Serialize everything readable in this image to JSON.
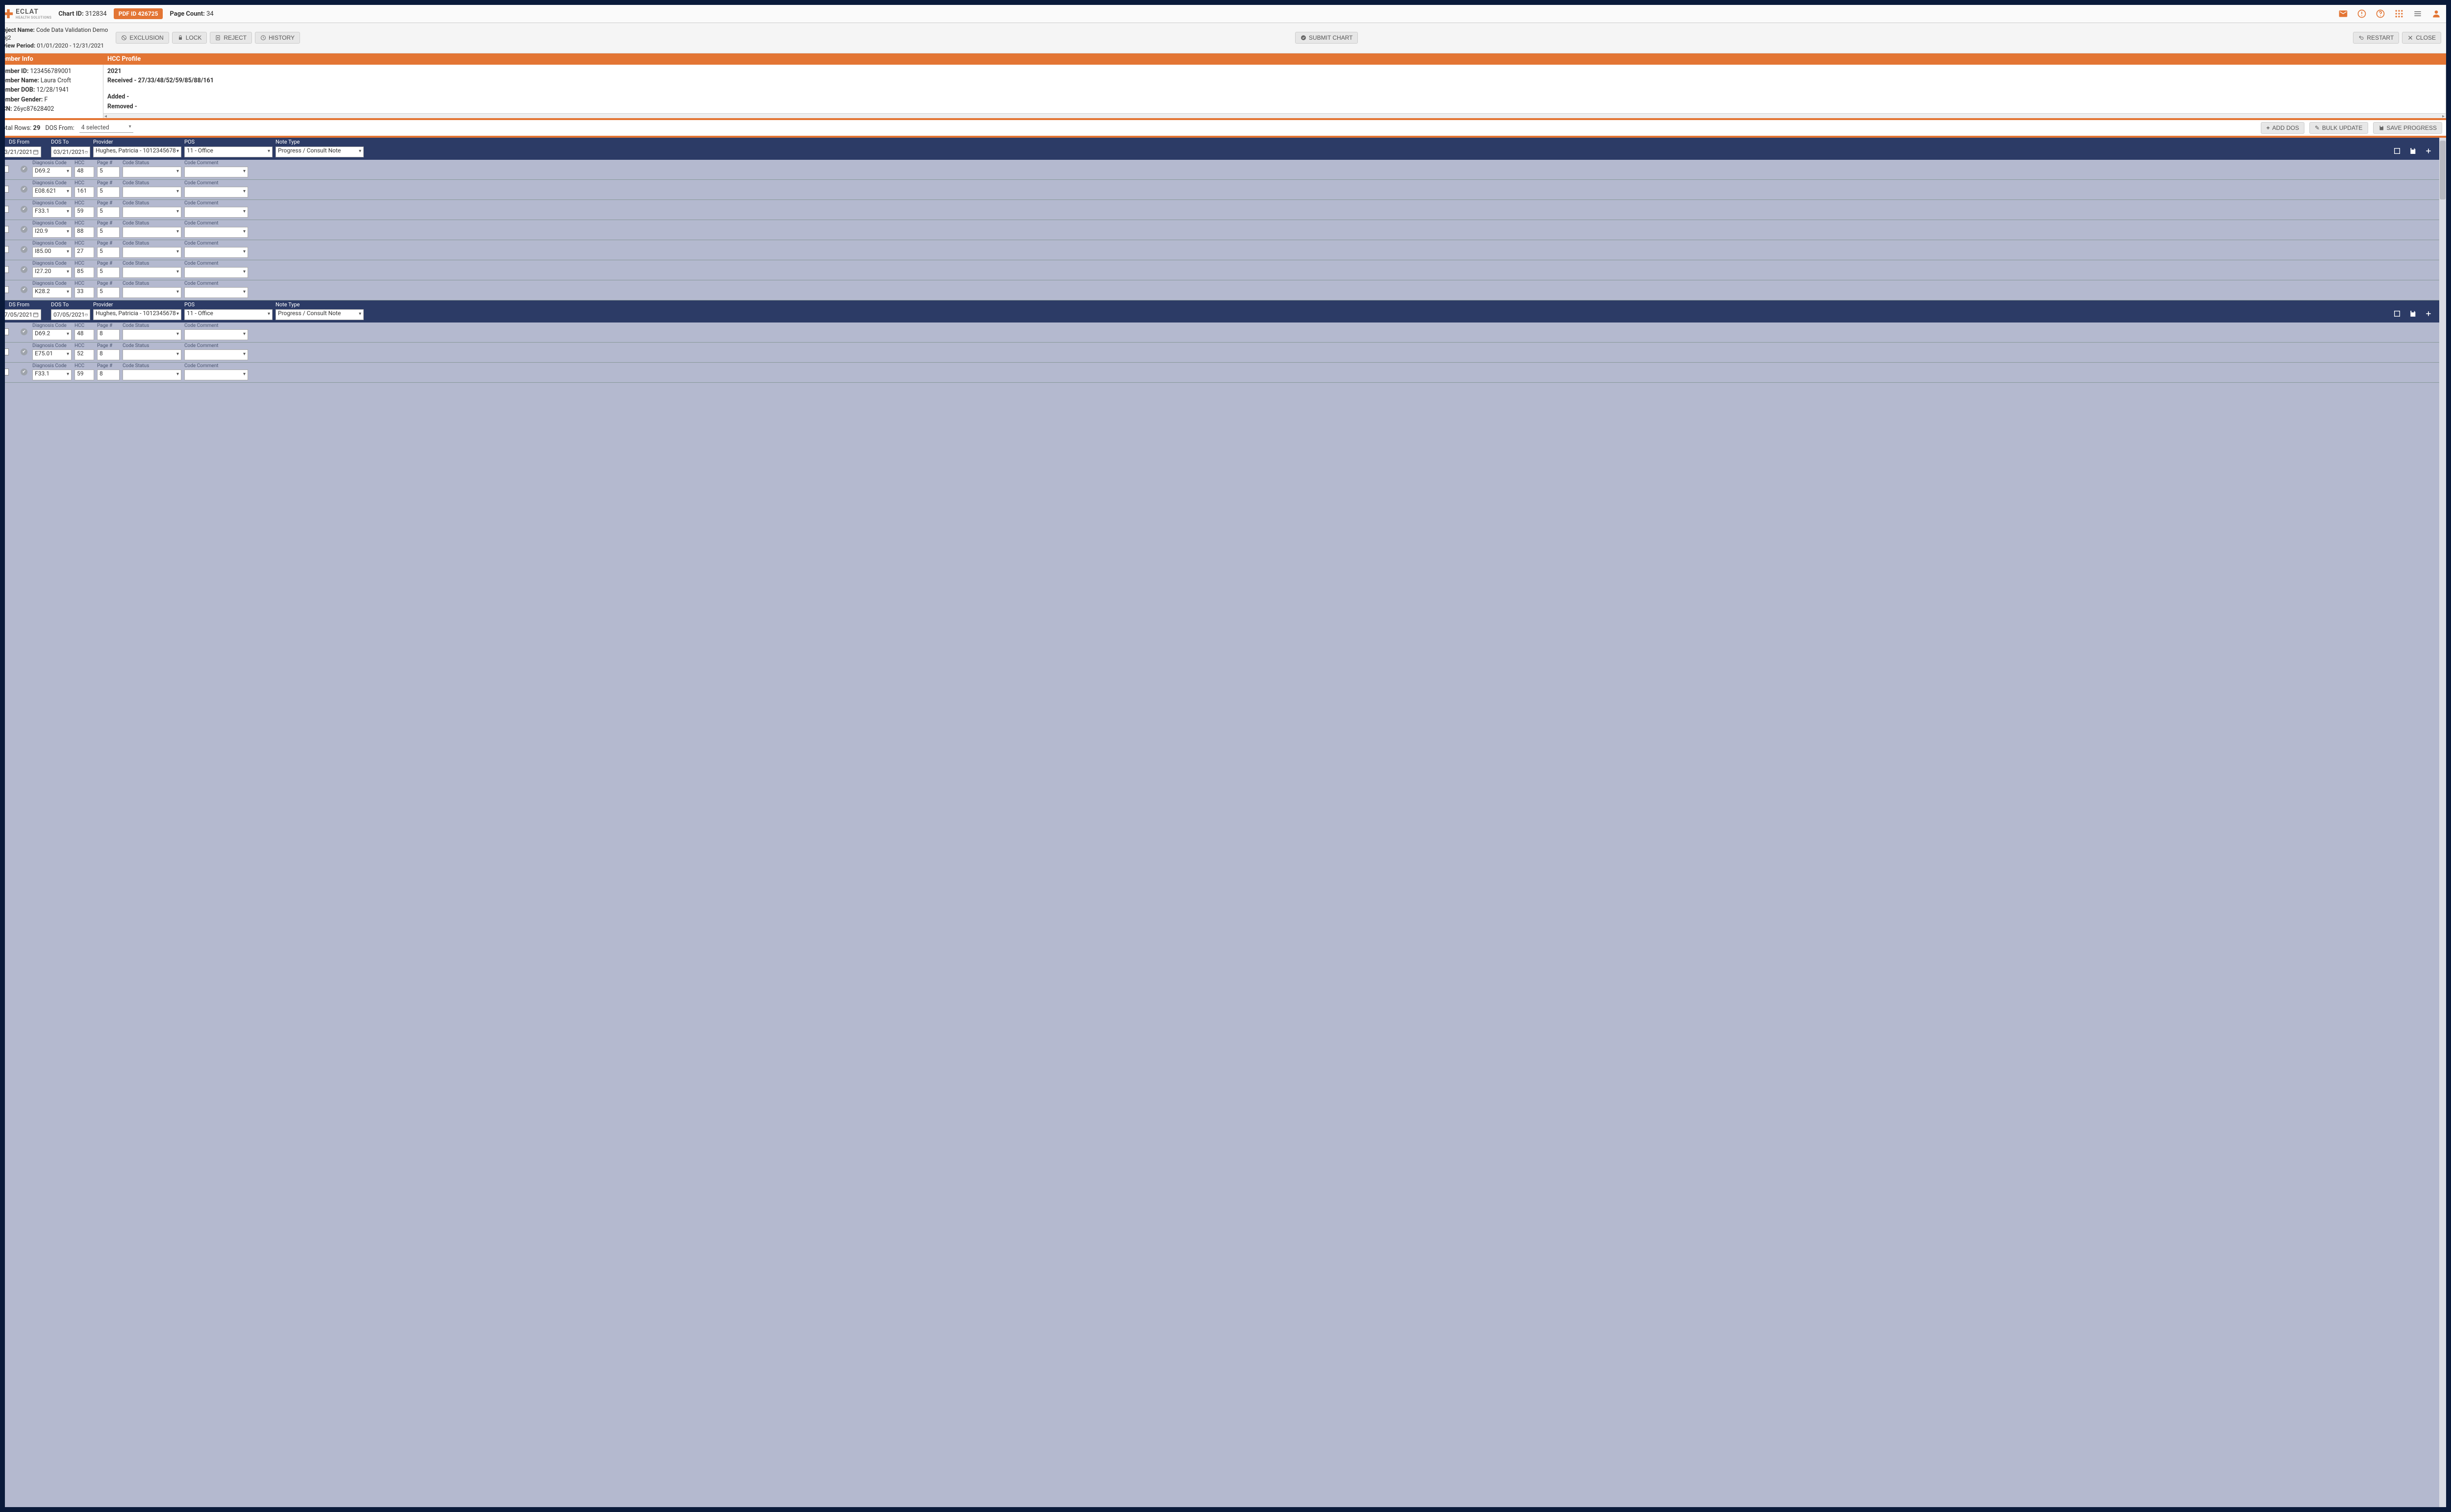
{
  "brand": {
    "name": "ECLAT",
    "sub": "HEALTH SOLUTIONS"
  },
  "header": {
    "chart_id_label": "Chart ID:",
    "chart_id": "312834",
    "pdf_badge": "PDF ID 426725",
    "page_count_label": "Page Count:",
    "page_count": "34"
  },
  "meta_left": {
    "project_name_label": "oject Name:",
    "project_name": "Code Data Validation Demo",
    "project_line2": "oj2",
    "review_period_label": "view Period:",
    "review_period": "01/01/2020 - 12/31/2021"
  },
  "action_buttons": {
    "exclusion": "EXCLUSION",
    "lock": "LOCK",
    "reject": "REJECT",
    "history": "HISTORY",
    "submit": "SUBMIT CHART",
    "restart": "RESTART",
    "close": "CLOSE"
  },
  "sections": {
    "member_info": "ember Info",
    "hcc_profile": "HCC Profile"
  },
  "member": {
    "id_label": "ember ID:",
    "id": "123456789001",
    "name_label": "ember Name:",
    "name": "Laura Croft",
    "dob_label": "ember DOB:",
    "dob": "12/28/1941",
    "gender_label": "ember Gender:",
    "gender": "F",
    "cn_label": "CN:",
    "cn": "26yc87628402"
  },
  "hcc": {
    "year": "2021",
    "received_label": "Received -",
    "received": "27/33/48/52/59/85/88/161",
    "added_label": "Added -",
    "added": "",
    "removed_label": "Removed -",
    "removed": ""
  },
  "controls": {
    "total_rows_label": "otal Rows:",
    "total_rows": "29",
    "dos_from_label": "DOS From:",
    "dos_from_value": "4 selected",
    "add_dos": "ADD DOS",
    "bulk_update": "BULK UPDATE",
    "save_progress": "SAVE PROGRESS"
  },
  "dos_labels": {
    "dos_from": "DS From",
    "dos_to": "DOS To",
    "provider": "Provider",
    "pos": "POS",
    "note_type": "Note Type"
  },
  "diag_labels": {
    "diagnosis_code": "Diagnosis Code",
    "hcc": "HCC",
    "page": "Page #",
    "code_status": "Code Status",
    "code_comment": "Code Comment"
  },
  "dos_groups": [
    {
      "dos_from": "3/21/2021",
      "dos_to": "03/21/2021",
      "provider": "Hughes, Patricia - 1012345678",
      "pos": "11 - Office",
      "note_type": "Progress / Consult Note",
      "diags": [
        {
          "code": "D69.2",
          "hcc": "48",
          "page": "5"
        },
        {
          "code": "E08.621",
          "hcc": "161",
          "page": "5"
        },
        {
          "code": "F33.1",
          "hcc": "59",
          "page": "5"
        },
        {
          "code": "I20.9",
          "hcc": "88",
          "page": "5"
        },
        {
          "code": "I85.00",
          "hcc": "27",
          "page": "5"
        },
        {
          "code": "I27.20",
          "hcc": "85",
          "page": "5"
        },
        {
          "code": "K28.2",
          "hcc": "33",
          "page": "5"
        }
      ]
    },
    {
      "dos_from": "7/05/2021",
      "dos_to": "07/05/2021",
      "provider": "Hughes, Patricia - 1012345678",
      "pos": "11 - Office",
      "note_type": "Progress / Consult Note",
      "diags": [
        {
          "code": "D69.2",
          "hcc": "48",
          "page": "8"
        },
        {
          "code": "E75.01",
          "hcc": "52",
          "page": "8"
        },
        {
          "code": "F33.1",
          "hcc": "59",
          "page": "8"
        }
      ]
    }
  ]
}
